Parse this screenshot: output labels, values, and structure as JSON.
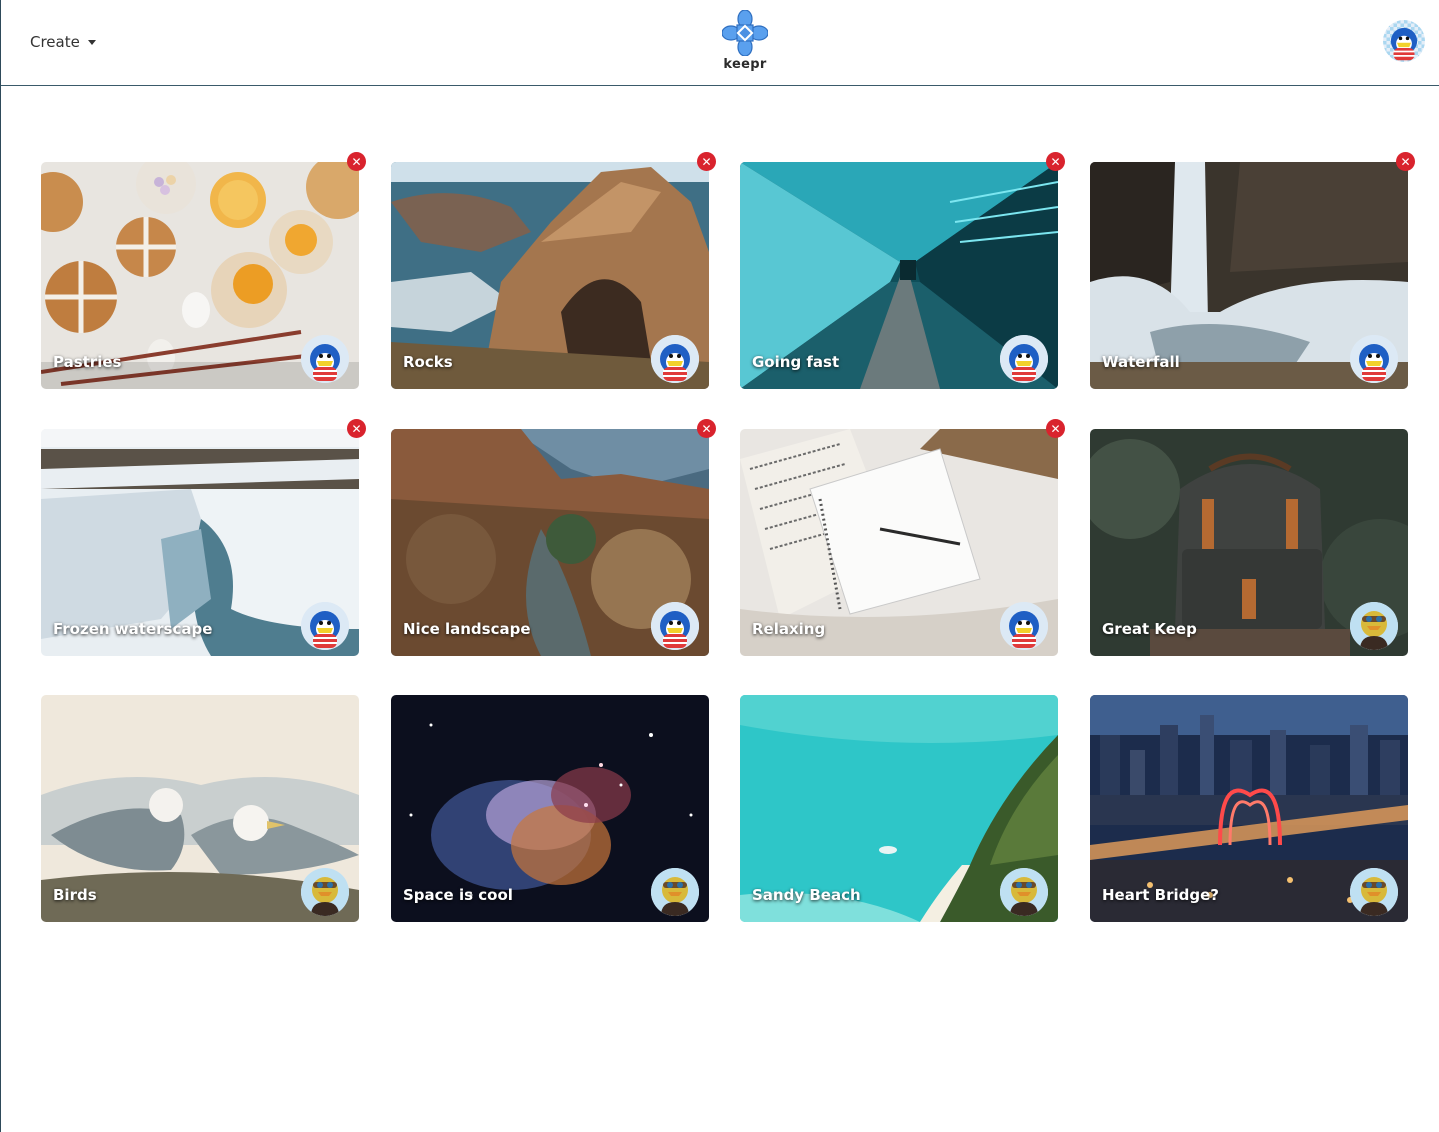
{
  "navbar": {
    "create_label": "Create",
    "logo_text": "keepr",
    "logo_color": "#4a90e2"
  },
  "delete_glyph": "✕",
  "keeps": [
    {
      "title": "Pastries",
      "deletable": true,
      "owner": "penguin",
      "scene": "pastries"
    },
    {
      "title": "Rocks",
      "deletable": true,
      "owner": "penguin",
      "scene": "rocks"
    },
    {
      "title": "Going fast",
      "deletable": true,
      "owner": "penguin",
      "scene": "tunnel"
    },
    {
      "title": "Waterfall",
      "deletable": true,
      "owner": "penguin",
      "scene": "waterfall"
    },
    {
      "title": "Frozen waterscape",
      "deletable": true,
      "owner": "penguin",
      "scene": "frozen"
    },
    {
      "title": "Nice landscape",
      "deletable": true,
      "owner": "penguin",
      "scene": "canyon"
    },
    {
      "title": "Relaxing",
      "deletable": true,
      "owner": "penguin",
      "scene": "notebook"
    },
    {
      "title": "Great Keep",
      "deletable": false,
      "owner": "duck",
      "scene": "backpack"
    },
    {
      "title": "Birds",
      "deletable": false,
      "owner": "duck",
      "scene": "birds"
    },
    {
      "title": "Space is cool",
      "deletable": false,
      "owner": "duck",
      "scene": "space"
    },
    {
      "title": "Sandy Beach",
      "deletable": false,
      "owner": "duck",
      "scene": "beach"
    },
    {
      "title": "Heart Bridge?",
      "deletable": false,
      "owner": "duck",
      "scene": "city"
    }
  ]
}
